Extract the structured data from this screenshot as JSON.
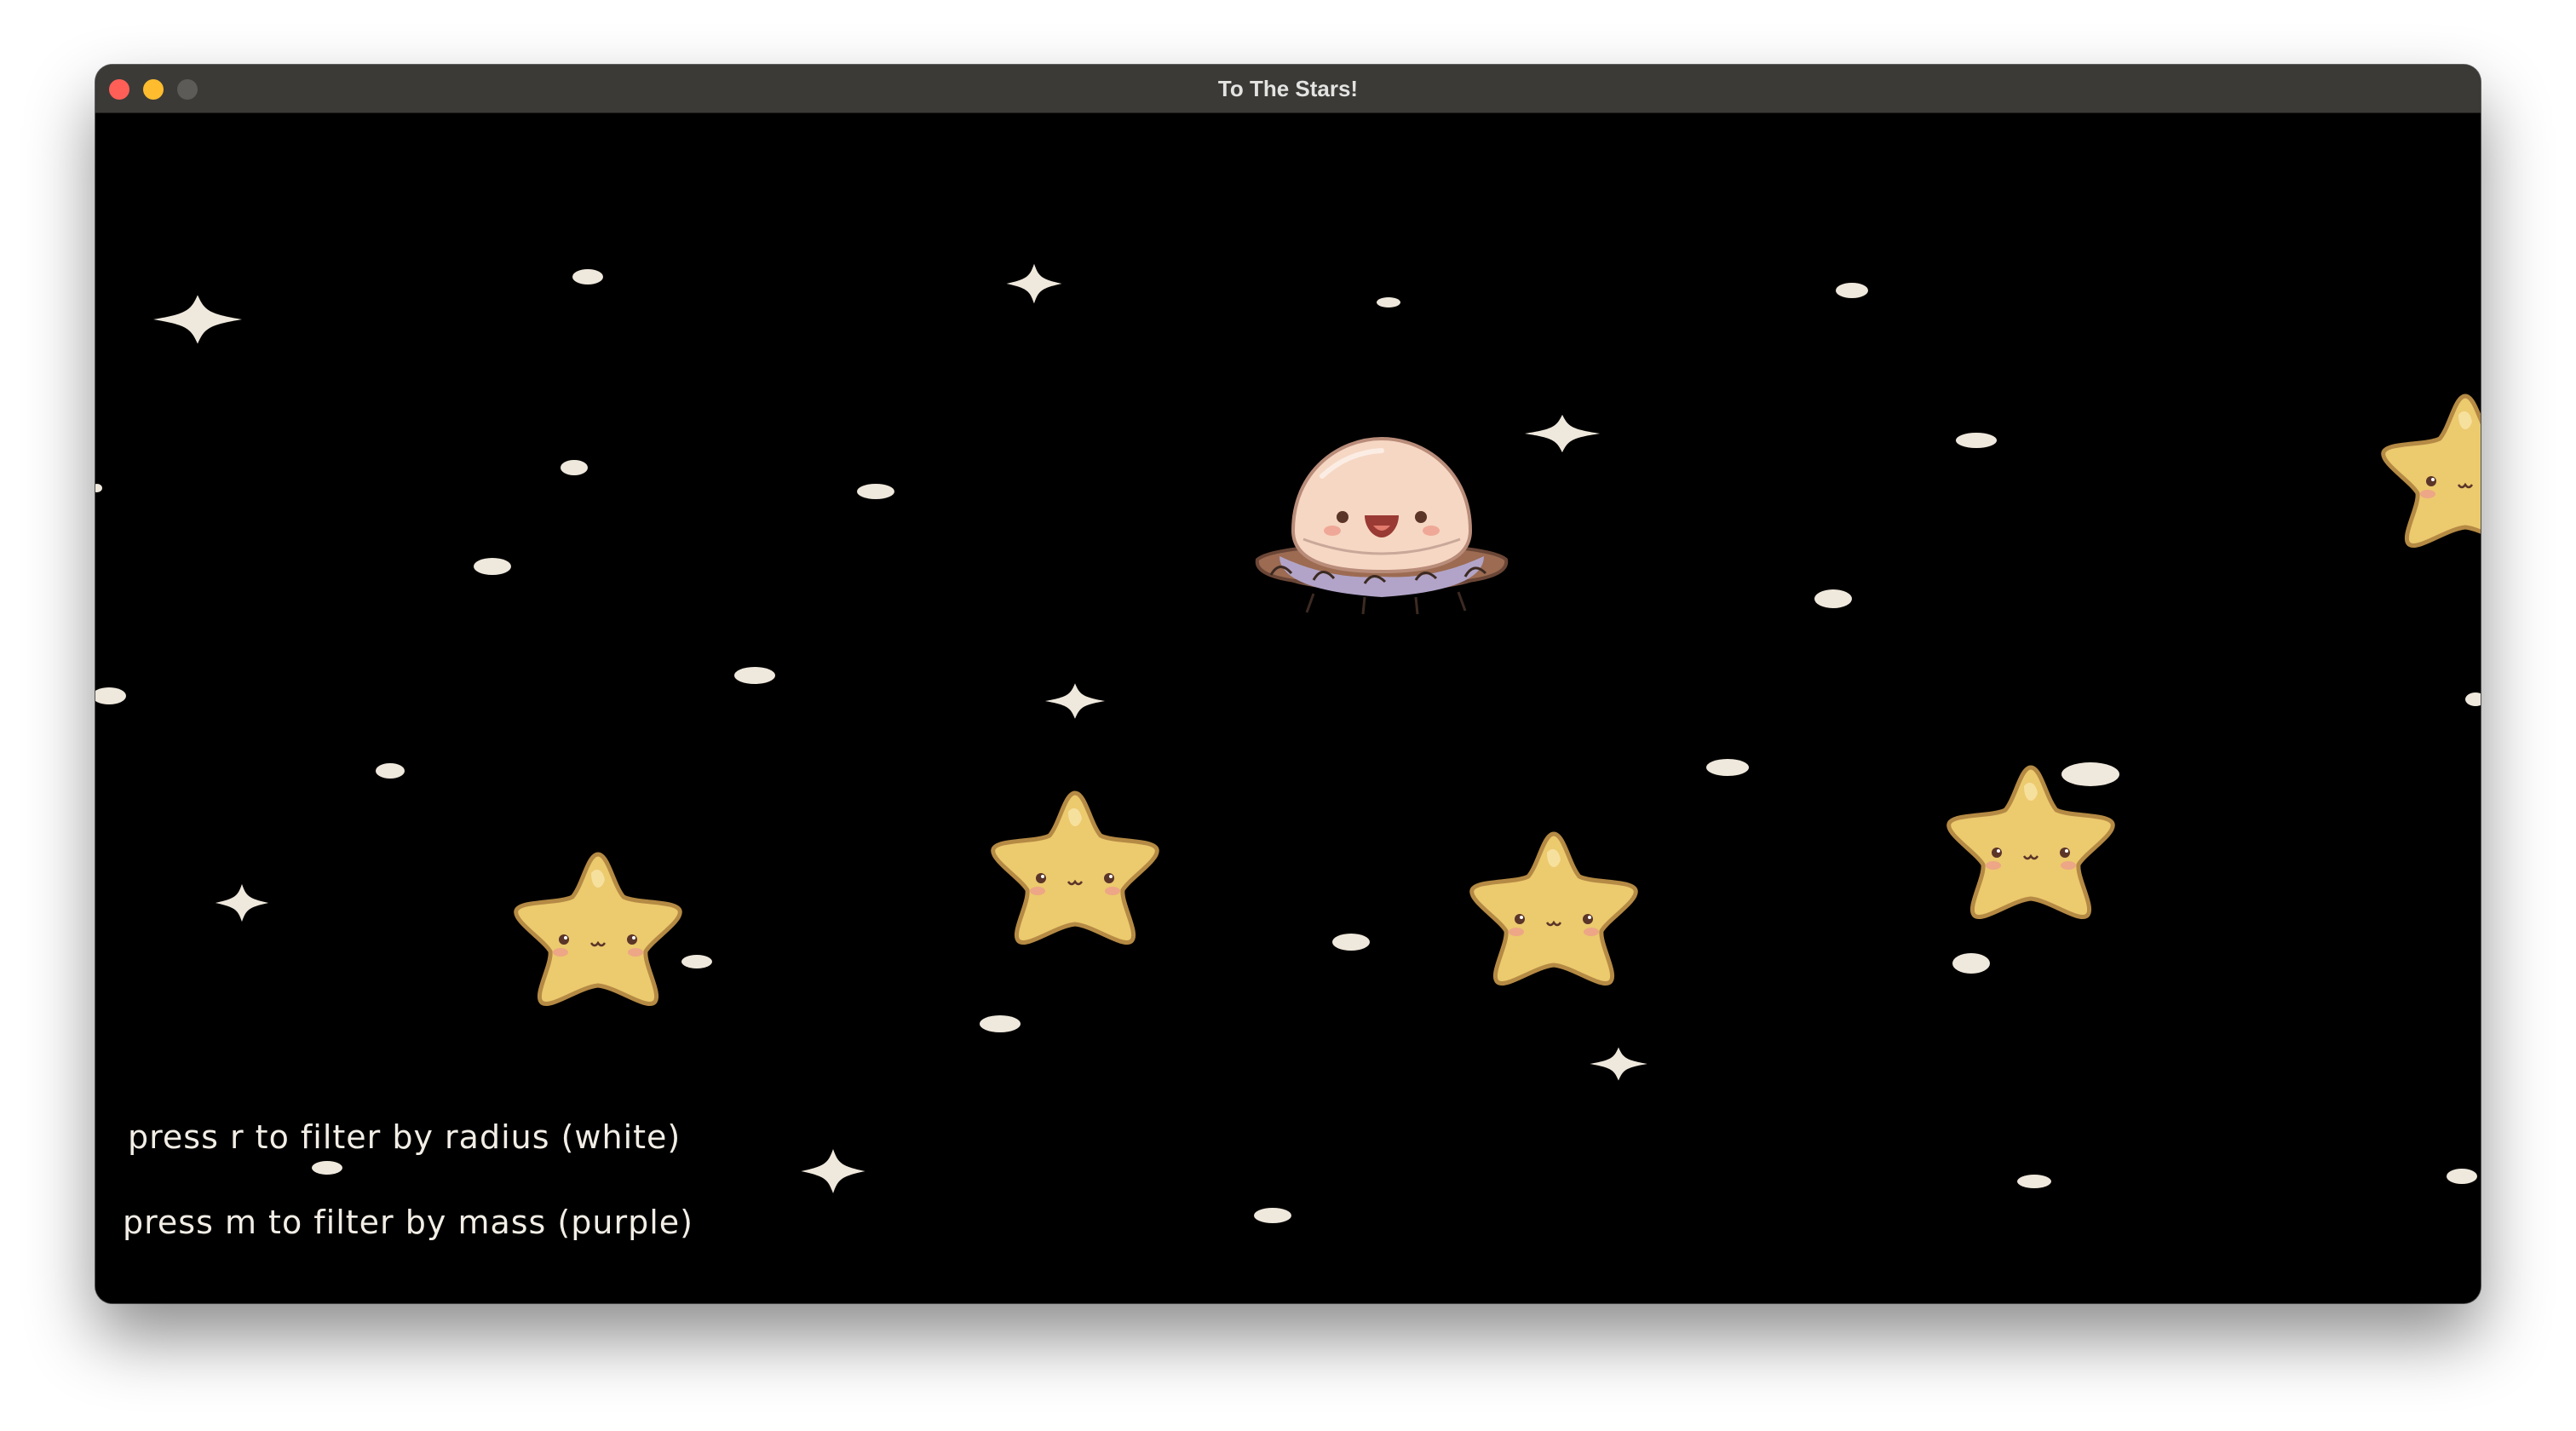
{
  "window": {
    "title": "To The Stars!",
    "controls": {
      "close_color": "#ff5f57",
      "minimize_color": "#febc2e",
      "maximize_color": "#5c5b58"
    }
  },
  "game": {
    "background_color": "#000000",
    "instructions": {
      "radius": "press r to filter by radius (white)",
      "mass": "press m to filter by mass (purple)"
    },
    "sprites": {
      "player": "ufo-creature",
      "stars": "smiling-yellow-star",
      "particles": "white-dust-and-sparkles"
    },
    "colors": {
      "star_fill": "#ecca6e",
      "star_outline": "#b58a44",
      "ufo_dome": "#f6d7c3",
      "ufo_rim": "#b2a4c8",
      "ufo_band": "#9c6b52",
      "dust": "#efe8dc",
      "text": "#f2eee6"
    }
  }
}
